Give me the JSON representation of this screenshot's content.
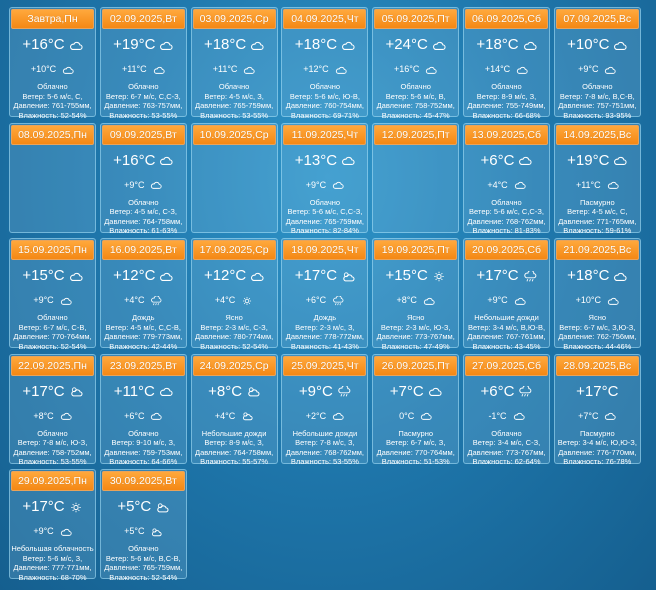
{
  "days": [
    {
      "date": "Завтра,Пн",
      "tday": "+16°C",
      "tnight": "+10°C",
      "cond": "Облачно",
      "wind": "Ветер: 5-6 м/с, С,",
      "pressure": "Давление: 761-755мм,",
      "humidity": "Влажность: 52-54%",
      "icon_day": "cloud-icon",
      "icon_night": "cloud-icon"
    },
    {
      "date": "02.09.2025,Вт",
      "tday": "+19°C",
      "tnight": "+11°C",
      "cond": "Облачно",
      "wind": "Ветер: 6-7 м/с, С,С-З,",
      "pressure": "Давление: 763-757мм,",
      "humidity": "Влажность: 53-55%",
      "icon_day": "cloud-icon",
      "icon_night": "cloud-icon"
    },
    {
      "date": "03.09.2025,Ср",
      "tday": "+18°C",
      "tnight": "+11°C",
      "cond": "Облачно",
      "wind": "Ветер: 4-5 м/с, З,",
      "pressure": "Давление: 765-759мм,",
      "humidity": "Влажность: 53-55%",
      "icon_day": "cloud-icon",
      "icon_night": "cloud-icon"
    },
    {
      "date": "04.09.2025,Чт",
      "tday": "+18°C",
      "tnight": "+12°C",
      "cond": "Облачно",
      "wind": "Ветер: 5-6 м/с, Ю-В,",
      "pressure": "Давление: 760-754мм,",
      "humidity": "Влажность: 69-71%",
      "icon_day": "cloud-icon",
      "icon_night": "cloud-icon"
    },
    {
      "date": "05.09.2025,Пт",
      "tday": "+24°C",
      "tnight": "+16°C",
      "cond": "Облачно",
      "wind": "Ветер: 5-6 м/с, В,",
      "pressure": "Давление: 758-752мм,",
      "humidity": "Влажность: 45-47%",
      "icon_day": "cloud-icon",
      "icon_night": "cloud-icon"
    },
    {
      "date": "06.09.2025,Сб",
      "tday": "+18°C",
      "tnight": "+14°C",
      "cond": "Облачно",
      "wind": "Ветер: 8-9 м/с, З,",
      "pressure": "Давление: 755-749мм,",
      "humidity": "Влажность: 66-68%",
      "icon_day": "cloud-icon",
      "icon_night": "cloud-icon"
    },
    {
      "date": "07.09.2025,Вс",
      "tday": "+10°C",
      "tnight": "+9°C",
      "cond": "Облачно",
      "wind": "Ветер: 7-8 м/с, В,С-В,",
      "pressure": "Давление: 757-751мм,",
      "humidity": "Влажность: 93-95%",
      "icon_day": "cloud-icon",
      "icon_night": "cloud-icon"
    },
    {
      "date": "08.09.2025,Пн",
      "tday": "",
      "tnight": "",
      "cond": "",
      "wind": "",
      "pressure": "",
      "humidity": "",
      "icon_day": "",
      "icon_night": ""
    },
    {
      "date": "09.09.2025,Вт",
      "tday": "+16°C",
      "tnight": "+9°C",
      "cond": "Облачно",
      "wind": "Ветер: 4-5 м/с, С-З,",
      "pressure": "Давление: 764-758мм,",
      "humidity": "Влажность: 61-63%",
      "icon_day": "cloud-icon",
      "icon_night": "cloud-icon"
    },
    {
      "date": "10.09.2025,Ср",
      "tday": "",
      "tnight": "",
      "cond": "",
      "wind": "",
      "pressure": "",
      "humidity": "",
      "icon_day": "",
      "icon_night": ""
    },
    {
      "date": "11.09.2025,Чт",
      "tday": "+13°C",
      "tnight": "+9°C",
      "cond": "Облачно",
      "wind": "Ветер: 5-6 м/с, С,С-З,",
      "pressure": "Давление: 765-759мм,",
      "humidity": "Влажность: 82-84%",
      "icon_day": "cloud-icon",
      "icon_night": "cloud-icon"
    },
    {
      "date": "12.09.2025,Пт",
      "tday": "",
      "tnight": "",
      "cond": "",
      "wind": "",
      "pressure": "",
      "humidity": "",
      "icon_day": "",
      "icon_night": ""
    },
    {
      "date": "13.09.2025,Сб",
      "tday": "+6°C",
      "tnight": "+4°C",
      "cond": "Облачно",
      "wind": "Ветер: 5-6 м/с, С,С-З,",
      "pressure": "Давление: 768-762мм,",
      "humidity": "Влажность: 81-83%",
      "icon_day": "cloud-icon",
      "icon_night": "cloud-icon"
    },
    {
      "date": "14.09.2025,Вс",
      "tday": "+19°C",
      "tnight": "+11°C",
      "cond": "Пасмурно",
      "wind": "Ветер: 4-5 м/с, С,",
      "pressure": "Давление: 771-765мм,",
      "humidity": "Влажность: 59-61%",
      "icon_day": "cloud-icon",
      "icon_night": "cloud-icon"
    },
    {
      "date": "15.09.2025,Пн",
      "tday": "+15°C",
      "tnight": "+9°C",
      "cond": "Облачно",
      "wind": "Ветер: 6-7 м/с, С-В,",
      "pressure": "Давление: 770-764мм,",
      "humidity": "Влажность: 52-54%",
      "icon_day": "cloud-icon",
      "icon_night": "cloud-icon"
    },
    {
      "date": "16.09.2025,Вт",
      "tday": "+12°C",
      "tnight": "+4°C",
      "cond": "Дождь",
      "wind": "Ветер: 4-5 м/с, С,С-В,",
      "pressure": "Давление: 779-773мм,",
      "humidity": "Влажность: 42-44%",
      "icon_day": "cloud-icon",
      "icon_night": "rain-icon"
    },
    {
      "date": "17.09.2025,Ср",
      "tday": "+12°C",
      "tnight": "+4°C",
      "cond": "Ясно",
      "wind": "Ветер: 2-3 м/с, С-З,",
      "pressure": "Давление: 780-774мм,",
      "humidity": "Влажность: 52-54%",
      "icon_day": "cloud-icon",
      "icon_night": "sun-icon"
    },
    {
      "date": "18.09.2025,Чт",
      "tday": "+17°C",
      "tnight": "+6°C",
      "cond": "Дождь",
      "wind": "Ветер: 2-3 м/с, З,",
      "pressure": "Давление: 778-772мм,",
      "humidity": "Влажность: 41-43%",
      "icon_day": "partly-cloudy-icon",
      "icon_night": "rain-icon"
    },
    {
      "date": "19.09.2025,Пт",
      "tday": "+15°C",
      "tnight": "+8°C",
      "cond": "Ясно",
      "wind": "Ветер: 2-3 м/с, Ю-З,",
      "pressure": "Давление: 773-767мм,",
      "humidity": "Влажность: 47-49%",
      "icon_day": "sun-icon",
      "icon_night": "cloud-icon"
    },
    {
      "date": "20.09.2025,Сб",
      "tday": "+17°C",
      "tnight": "+9°C",
      "cond": "Небольшие дожди",
      "wind": "Ветер: 3-4 м/с, В,Ю-В,",
      "pressure": "Давление: 767-761мм,",
      "humidity": "Влажность: 43-45%",
      "icon_day": "rain-icon",
      "icon_night": "cloud-icon"
    },
    {
      "date": "21.09.2025,Вс",
      "tday": "+18°C",
      "tnight": "+10°C",
      "cond": "Ясно",
      "wind": "Ветер: 6-7 м/с, З,Ю-З,",
      "pressure": "Давление: 762-756мм,",
      "humidity": "Влажность: 44-46%",
      "icon_day": "cloud-icon",
      "icon_night": "cloud-icon"
    },
    {
      "date": "22.09.2025,Пн",
      "tday": "+17°C",
      "tnight": "+8°C",
      "cond": "Облачно",
      "wind": "Ветер: 7-8 м/с, Ю-З,",
      "pressure": "Давление: 758-752мм,",
      "humidity": "Влажность: 53-55%",
      "icon_day": "partly-cloudy-icon",
      "icon_night": "cloud-icon"
    },
    {
      "date": "23.09.2025,Вт",
      "tday": "+11°C",
      "tnight": "+6°C",
      "cond": "Облачно",
      "wind": "Ветер: 9-10 м/с, З,",
      "pressure": "Давление: 759-753мм,",
      "humidity": "Влажность: 64-66%",
      "icon_day": "cloud-icon",
      "icon_night": "cloud-icon"
    },
    {
      "date": "24.09.2025,Ср",
      "tday": "+8°C",
      "tnight": "+4°C",
      "cond": "Небольшие дожди",
      "wind": "Ветер: 8-9 м/с, З,",
      "pressure": "Давление: 764-758мм,",
      "humidity": "Влажность: 55-57%",
      "icon_day": "partly-cloudy-icon",
      "icon_night": "partly-cloudy-icon"
    },
    {
      "date": "25.09.2025,Чт",
      "tday": "+9°C",
      "tnight": "+2°C",
      "cond": "Небольшие дожди",
      "wind": "Ветер: 7-8 м/с, З,",
      "pressure": "Давление: 768-762мм,",
      "humidity": "Влажность: 53-55%",
      "icon_day": "rain-icon",
      "icon_night": "cloud-icon"
    },
    {
      "date": "26.09.2025,Пт",
      "tday": "+7°C",
      "tnight": "0°C",
      "cond": "Пасмурно",
      "wind": "Ветер: 6-7 м/с, З,",
      "pressure": "Давление: 770-764мм,",
      "humidity": "Влажность: 51-53%",
      "icon_day": "cloud-icon",
      "icon_night": "cloud-icon"
    },
    {
      "date": "27.09.2025,Сб",
      "tday": "+6°C",
      "tnight": "-1°C",
      "cond": "Облачно",
      "wind": "Ветер: 3-4 м/с, С-З,",
      "pressure": "Давление: 773-767мм,",
      "humidity": "Влажность: 62-64%",
      "icon_day": "rain-icon",
      "icon_night": "cloud-icon"
    },
    {
      "date": "28.09.2025,Вс",
      "tday": "+17°C",
      "tnight": "+7°C",
      "cond": "Пасмурно",
      "wind": "Ветер: 3-4 м/с, Ю,Ю-З,",
      "pressure": "Давление: 776-770мм,",
      "humidity": "Влажность: 76-78%",
      "icon_day": "",
      "icon_night": "cloud-icon"
    },
    {
      "date": "29.09.2025,Пн",
      "tday": "+17°C",
      "tnight": "+9°C",
      "cond": "Небольшая облачность",
      "wind": "Ветер: 5-6 м/с, З,",
      "pressure": "Давление: 777-771мм,",
      "humidity": "Влажность: 68-70%",
      "icon_day": "sun-icon",
      "icon_night": "cloud-icon"
    },
    {
      "date": "30.09.2025,Вт",
      "tday": "+5°C",
      "tnight": "+5°C",
      "cond": "Облачно",
      "wind": "Ветер: 5-6 м/с, В,С-В,",
      "pressure": "Давление: 765-759мм,",
      "humidity": "Влажность: 52-54%",
      "icon_day": "partly-cloudy-icon",
      "icon_night": "partly-cloudy-icon"
    }
  ]
}
